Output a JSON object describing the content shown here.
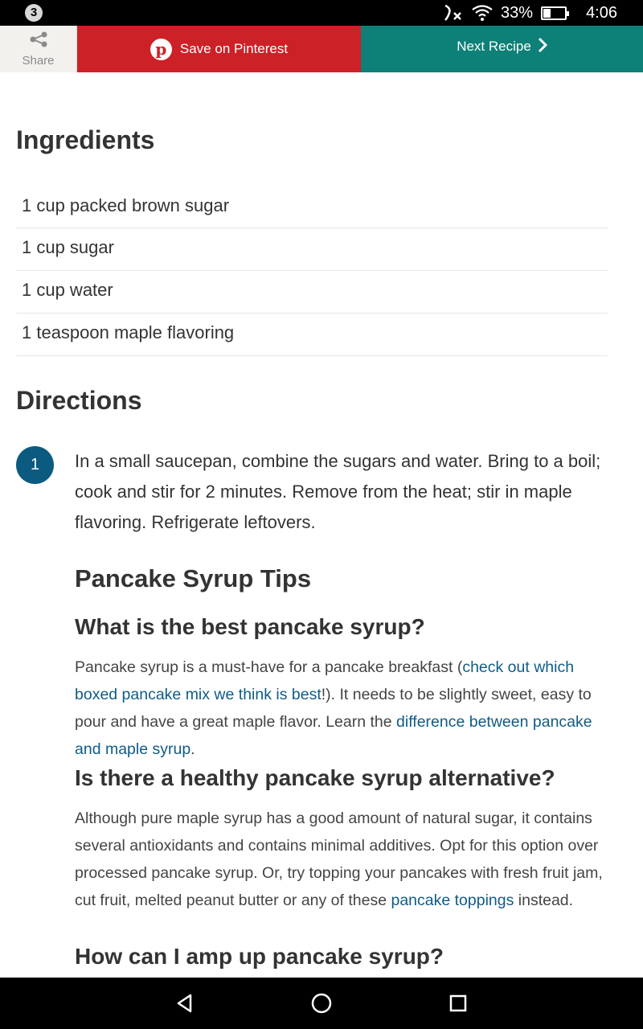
{
  "status_bar": {
    "notification_count": "3",
    "battery_percent": "33%",
    "battery_level": 0.33,
    "time": "4:06"
  },
  "action_bar": {
    "share_label": "Share",
    "pinterest_label": "Save on Pinterest",
    "next_label": "Next Recipe",
    "colors": {
      "pinterest": "#cc2127",
      "next": "#0d8077",
      "share_bg": "#f3f1ee"
    }
  },
  "ingredients": {
    "title": "Ingredients",
    "items": [
      "1 cup packed brown sugar",
      "1 cup sugar",
      "1 cup water",
      "1 teaspoon maple flavoring"
    ]
  },
  "directions": {
    "title": "Directions",
    "steps": [
      {
        "number": "1",
        "text": "In a small saucepan, combine the sugars and water. Bring to a boil; cook and stir for 2 minutes. Remove from the heat; stir in maple flavoring. Refrigerate leftovers."
      }
    ]
  },
  "tips": {
    "title": "Pancake Syrup Tips",
    "q1": {
      "heading": "What is the best pancake syrup?",
      "text_a": "Pancake syrup is a must-have for a pancake breakfast (",
      "link_a": "check out which boxed pancake mix we think is best",
      "text_b": "!). It needs to be slightly sweet, easy to pour and have a great maple flavor. Learn the ",
      "link_b": "difference between pancake and maple syrup",
      "text_c": "."
    },
    "q2": {
      "heading": "Is there a healthy pancake syrup alternative?",
      "text_a": "Although pure maple syrup has a good amount of natural sugar, it contains several antioxidants and contains minimal additives. Opt for this option over processed pancake syrup. Or, try topping your pancakes with fresh fruit jam, cut fruit, melted peanut butter or any of these ",
      "link_a": "pancake toppings",
      "text_b": " instead."
    },
    "q3": {
      "heading": "How can I amp up pancake syrup?"
    }
  },
  "nav_bar": {
    "back_icon": "back-triangle-icon",
    "home_icon": "home-circle-icon",
    "recents_icon": "recents-square-icon"
  }
}
